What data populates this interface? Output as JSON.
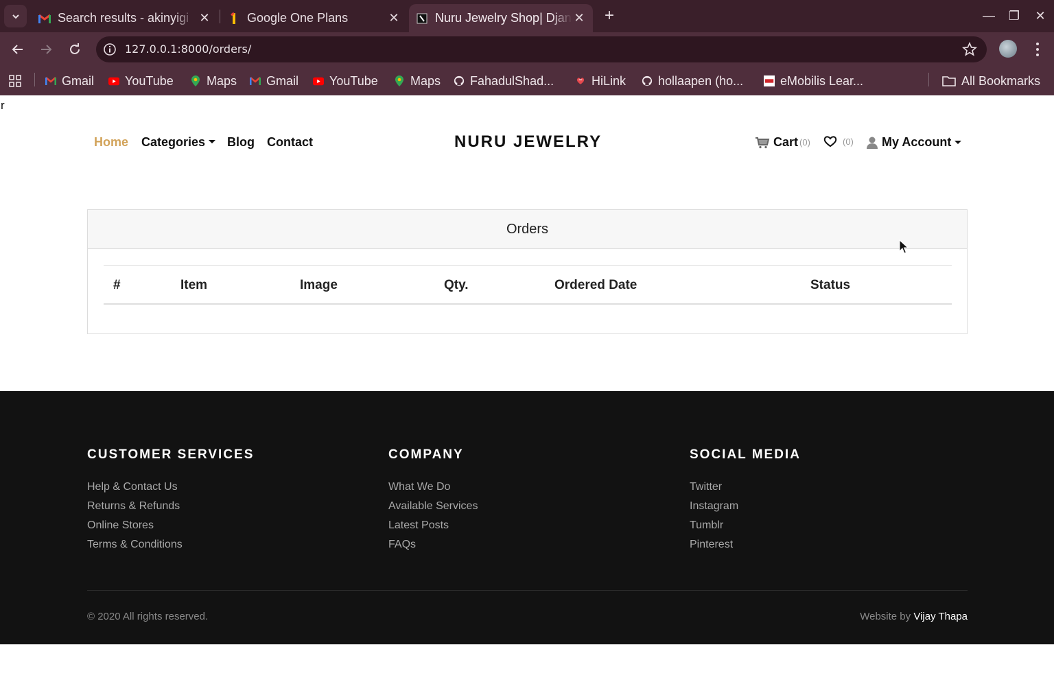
{
  "browser": {
    "tabs": [
      {
        "title": "Search results - akinyigi",
        "icon": "gmail-icon"
      },
      {
        "title": "Google One Plans",
        "icon": "google-one-icon"
      },
      {
        "title": "Nuru Jewelry Shop| Django",
        "icon": "site-favicon",
        "active": true
      }
    ],
    "url": "127.0.0.1:8000/orders/",
    "bookmarks": [
      {
        "label": "Gmail",
        "icon": "gmail-icon"
      },
      {
        "label": "YouTube",
        "icon": "youtube-icon"
      },
      {
        "label": "Maps",
        "icon": "maps-icon"
      },
      {
        "label": "Gmail",
        "icon": "gmail-icon"
      },
      {
        "label": "YouTube",
        "icon": "youtube-icon"
      },
      {
        "label": "Maps",
        "icon": "maps-icon"
      },
      {
        "label": "FahadulShad...",
        "icon": "github-icon"
      },
      {
        "label": "HiLink",
        "icon": "hilink-icon"
      },
      {
        "label": "hollaapen (ho...",
        "icon": "github-icon"
      },
      {
        "label": "eMobilis Lear...",
        "icon": "emobilis-icon"
      }
    ],
    "all_bookmarks": "All Bookmarks"
  },
  "page": {
    "stray_text": "r",
    "nav": {
      "home": "Home",
      "categories": "Categories",
      "blog": "Blog",
      "contact": "Contact",
      "brand": "NURU JEWELRY",
      "cart_label": "Cart",
      "cart_count": "(0)",
      "wishlist_count": "(0)",
      "account": "My Account"
    },
    "orders": {
      "title": "Orders",
      "columns": [
        "#",
        "Item",
        "Image",
        "Qty.",
        "Ordered Date",
        "Status"
      ]
    },
    "footer": {
      "customer_services": {
        "heading": "CUSTOMER SERVICES",
        "links": [
          "Help & Contact Us",
          "Returns & Refunds",
          "Online Stores",
          "Terms & Conditions"
        ]
      },
      "company": {
        "heading": "COMPANY",
        "links": [
          "What We Do",
          "Available Services",
          "Latest Posts",
          "FAQs"
        ]
      },
      "social_media": {
        "heading": "SOCIAL MEDIA",
        "links": [
          "Twitter",
          "Instagram",
          "Tumblr",
          "Pinterest"
        ]
      },
      "copyright": "© 2020 All rights reserved.",
      "credit_prefix": "Website by",
      "credit_name": "Vijay Thapa"
    }
  },
  "colors": {
    "chrome_dark": "#3a1f2a",
    "chrome": "#4f2e3c",
    "accent": "#d2a35a",
    "footer_bg": "#121212"
  }
}
